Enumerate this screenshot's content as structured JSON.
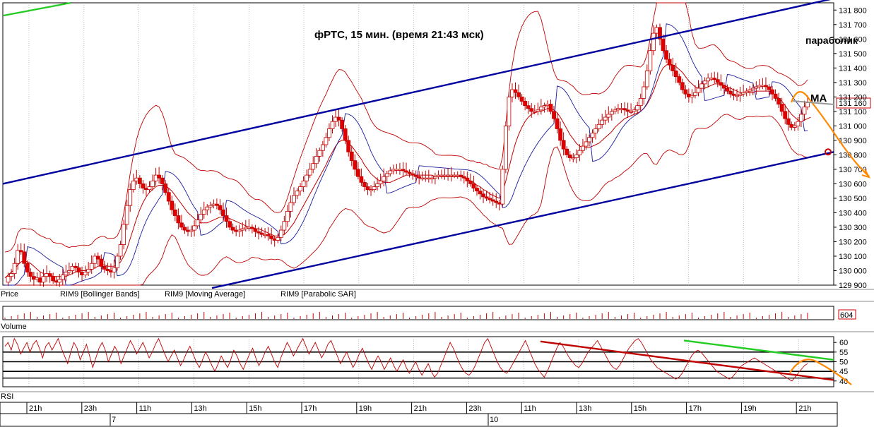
{
  "chart_data": {
    "type": "line",
    "title": "фРТС,  15 мин.  (время 21:43 мск)",
    "annotations": {
      "parabolic": "параболик",
      "ma": "MA"
    },
    "price_panel": {
      "label": "Price",
      "ylim": [
        129900,
        131850
      ],
      "yticks": [
        "131 800",
        "131 700",
        "131 600",
        "131 500",
        "131 400",
        "131 300",
        "131 200",
        "131 100",
        "131 000",
        "130 900",
        "130 800",
        "130 700",
        "130 600",
        "130 500",
        "130 400",
        "130 300",
        "130 200",
        "130 100",
        "130 000",
        "129 900"
      ],
      "ytick_values": [
        131800,
        131700,
        131600,
        131500,
        131400,
        131300,
        131200,
        131100,
        131000,
        130900,
        130800,
        130700,
        130600,
        130500,
        130400,
        130300,
        130200,
        130100,
        130000,
        129900
      ],
      "current_price_label": "131 160",
      "current_price": 131160,
      "legend": [
        "RIM9 [Bollinger Bands]",
        "RIM9 [Moving Average]",
        "RIM9 [Parabolic SAR]"
      ],
      "candles": [
        129920,
        129960,
        129980,
        130050,
        130140,
        130130,
        130050,
        129990,
        129960,
        129940,
        129950,
        129920,
        129960,
        129980,
        129960,
        129930,
        129920,
        129940,
        129970,
        129990,
        130000,
        130030,
        130020,
        129990,
        129970,
        129990,
        130010,
        130050,
        130100,
        130080,
        130030,
        130010,
        130000,
        129990,
        130020,
        130100,
        130180,
        130320,
        130450,
        130560,
        130620,
        130640,
        130600,
        130570,
        130560,
        130580,
        130620,
        130660,
        130640,
        130600,
        130540,
        130480,
        130420,
        130380,
        130330,
        130300,
        130280,
        130270,
        130280,
        130310,
        130350,
        130390,
        130420,
        130440,
        130450,
        130460,
        130450,
        130420,
        130380,
        130340,
        130300,
        130280,
        130270,
        130280,
        130290,
        130300,
        130300,
        130290,
        130270,
        130260,
        130250,
        130250,
        130240,
        130220,
        130210,
        130230,
        130280,
        130340,
        130410,
        130470,
        130520,
        130550,
        130580,
        130620,
        130660,
        130700,
        130740,
        130790,
        130830,
        130870,
        130920,
        130980,
        131030,
        131060,
        131040,
        130980,
        130900,
        130820,
        130760,
        130700,
        130650,
        130610,
        130580,
        130560,
        130560,
        130580,
        130600,
        130620,
        130650,
        130670,
        130690,
        130700,
        130700,
        130700,
        130690,
        130680,
        130670,
        130660,
        130650,
        130640,
        130640,
        130640,
        130640,
        130640,
        130650,
        130660,
        130660,
        130660,
        130660,
        130660,
        130660,
        130660,
        130650,
        130640,
        130620,
        130600,
        130570,
        130550,
        130530,
        130510,
        130500,
        130490,
        130480,
        130470,
        130460,
        130700,
        131000,
        131200,
        131250,
        131230,
        131200,
        131170,
        131140,
        131120,
        131100,
        131100,
        131110,
        131130,
        131140,
        131150,
        131100,
        131050,
        130980,
        130900,
        130840,
        130800,
        130780,
        130780,
        130800,
        130830,
        130860,
        130890,
        130920,
        130950,
        130980,
        131010,
        131040,
        131060,
        131080,
        131100,
        131110,
        131120,
        131120,
        131110,
        131100,
        131100,
        131110,
        131140,
        131190,
        131270,
        131380,
        131520,
        131640,
        131680,
        131600,
        131520,
        131460,
        131420,
        131380,
        131340,
        131300,
        131250,
        131220,
        131200,
        131210,
        131230,
        131260,
        131290,
        131310,
        131330,
        131330,
        131320,
        131300,
        131280,
        131260,
        131240,
        131220,
        131210,
        131210,
        131220,
        131230,
        131240,
        131250,
        131260,
        131270,
        131280,
        131280,
        131270,
        131250,
        131220,
        131190,
        131150,
        131100,
        131050,
        131010,
        130990,
        131000,
        131030,
        131080,
        131130,
        131160
      ],
      "ma": [
        129950,
        129970,
        129990,
        130010,
        130040,
        130060,
        130070,
        130060,
        130050,
        130030,
        130010,
        129990,
        129980,
        129970,
        129970,
        129960,
        129960,
        129960,
        129960,
        129960,
        129970,
        129980,
        129990,
        130000,
        130000,
        130000,
        130000,
        130010,
        130020,
        130030,
        130040,
        130040,
        130030,
        130030,
        130030,
        130040,
        130060,
        130100,
        130150,
        130220,
        130290,
        130360,
        130420,
        130470,
        130510,
        130540,
        130560,
        130580,
        130590,
        130590,
        130590,
        130570,
        130550,
        130520,
        130490,
        130460,
        130430,
        130400,
        130380,
        130360,
        130340,
        130330,
        130330,
        130330,
        130340,
        130350,
        130360,
        130370,
        130370,
        130370,
        130360,
        130350,
        130340,
        130330,
        130320,
        130310,
        130300,
        130300,
        130290,
        130290,
        130280,
        130270,
        130260,
        130250,
        130240,
        130240,
        130240,
        130250,
        130270,
        130300,
        130330,
        130370,
        130410,
        130450,
        130490,
        130530,
        130570,
        130610,
        130650,
        130690,
        130730,
        130780,
        130820,
        130860,
        130890,
        130900,
        130900,
        130880,
        130860,
        130830,
        130800,
        130770,
        130730,
        130700,
        130670,
        130650,
        130630,
        130620,
        130610,
        130610,
        130610,
        130620,
        130630,
        130640,
        130650,
        130660,
        130660,
        130660,
        130660,
        130660,
        130660,
        130660,
        130660,
        130660,
        130650,
        130650,
        130650,
        130650,
        130650,
        130650,
        130650,
        130650,
        130650,
        130640,
        130630,
        130620,
        130610,
        130590,
        130580,
        130560,
        130550,
        130530,
        130520,
        130510,
        130500,
        130540,
        130620,
        130710,
        130800,
        130880,
        130940,
        130990,
        131030,
        131060,
        131080,
        131090,
        131100,
        131100,
        131110,
        131120,
        131120,
        131110,
        131090,
        131060,
        131020,
        130980,
        130940,
        130910,
        130880,
        130860,
        130850,
        130850,
        130850,
        130860,
        130870,
        130880,
        130900,
        130920,
        130940,
        130960,
        130990,
        131010,
        131030,
        131050,
        131060,
        131070,
        131080,
        131090,
        131100,
        131120,
        131150,
        131190,
        131240,
        131300,
        131360,
        131400,
        131420,
        131430,
        131420,
        131410,
        131390,
        131370,
        131340,
        131310,
        131290,
        131270,
        131260,
        131260,
        131260,
        131270,
        131280,
        131290,
        131290,
        131290,
        131280,
        131270,
        131260,
        131250,
        131240,
        131230,
        131230,
        131230,
        131230,
        131230,
        131240,
        131240,
        131240,
        131240,
        131240,
        131230,
        131210,
        131190,
        131170,
        131140,
        131110,
        131080,
        131060,
        131040,
        131040,
        131040,
        131050,
        131060
      ]
    },
    "volume_panel": {
      "label": "Volume",
      "current_label": "604",
      "current_value": 604
    },
    "rsi_panel": {
      "label": "RSI",
      "ylim": [
        37,
        63
      ],
      "yticks": [
        "60",
        "55",
        "50",
        "45",
        "40"
      ],
      "ytick_values": [
        60,
        55,
        50,
        45,
        40
      ],
      "levels": [
        55,
        50,
        45
      ],
      "values": [
        58,
        60,
        56,
        62,
        59,
        54,
        57,
        60,
        55,
        59,
        61,
        57,
        52,
        58,
        60,
        56,
        59,
        62,
        57,
        53,
        49,
        55,
        60,
        57,
        51,
        55,
        59,
        53,
        47,
        52,
        57,
        60,
        56,
        50,
        54,
        58,
        55,
        49,
        53,
        57,
        61,
        58,
        54,
        57,
        60,
        56,
        52,
        55,
        59,
        62,
        58,
        54,
        50,
        53,
        56,
        52,
        48,
        51,
        55,
        58,
        54,
        50,
        47,
        51,
        55,
        52,
        48,
        45,
        49,
        53,
        50,
        47,
        51,
        56,
        53,
        49,
        46,
        50,
        54,
        57,
        52,
        48,
        51,
        55,
        58,
        54,
        50,
        47,
        52,
        56,
        60,
        57,
        53,
        56,
        59,
        62,
        58,
        54,
        57,
        60,
        56,
        52,
        55,
        59,
        61,
        57,
        53,
        49,
        52,
        55,
        51,
        47,
        50,
        54,
        57,
        53,
        49,
        46,
        50,
        53,
        50,
        46,
        49,
        52,
        48,
        45,
        48,
        51,
        47,
        44,
        47,
        50,
        46,
        43,
        46,
        49,
        45,
        42,
        44,
        48,
        52,
        56,
        60,
        57,
        53,
        49,
        46,
        44,
        43,
        45,
        48,
        52,
        56,
        60,
        62,
        58,
        54,
        50,
        47,
        45,
        44,
        46,
        49,
        52,
        55,
        58,
        61,
        57,
        53,
        49,
        46,
        44,
        42,
        45,
        49,
        53,
        57,
        60,
        58,
        55,
        52,
        50,
        48,
        47,
        49,
        52,
        55,
        57,
        59,
        61,
        58,
        55,
        52,
        49,
        47,
        46,
        48,
        51,
        54,
        57,
        59,
        61,
        62,
        60,
        57,
        54,
        51,
        49,
        47,
        46,
        45,
        44,
        43,
        42,
        41,
        42,
        44,
        47,
        50,
        53,
        55,
        56,
        55,
        53,
        51,
        49,
        47,
        45,
        44,
        43,
        42,
        41,
        42,
        44,
        46,
        48,
        49,
        50,
        51,
        52,
        51,
        50,
        49,
        48,
        47,
        46,
        45,
        44,
        43,
        42,
        41,
        40,
        42,
        44,
        46,
        48,
        49
      ]
    },
    "time_axis": {
      "ticks": [
        "21h",
        "23h",
        "11h",
        "13h",
        "15h",
        "17h",
        "19h",
        "21h",
        "23h",
        "11h",
        "13h",
        "15h",
        "17h",
        "19h",
        "21h"
      ],
      "days": [
        "7",
        "10"
      ]
    }
  }
}
